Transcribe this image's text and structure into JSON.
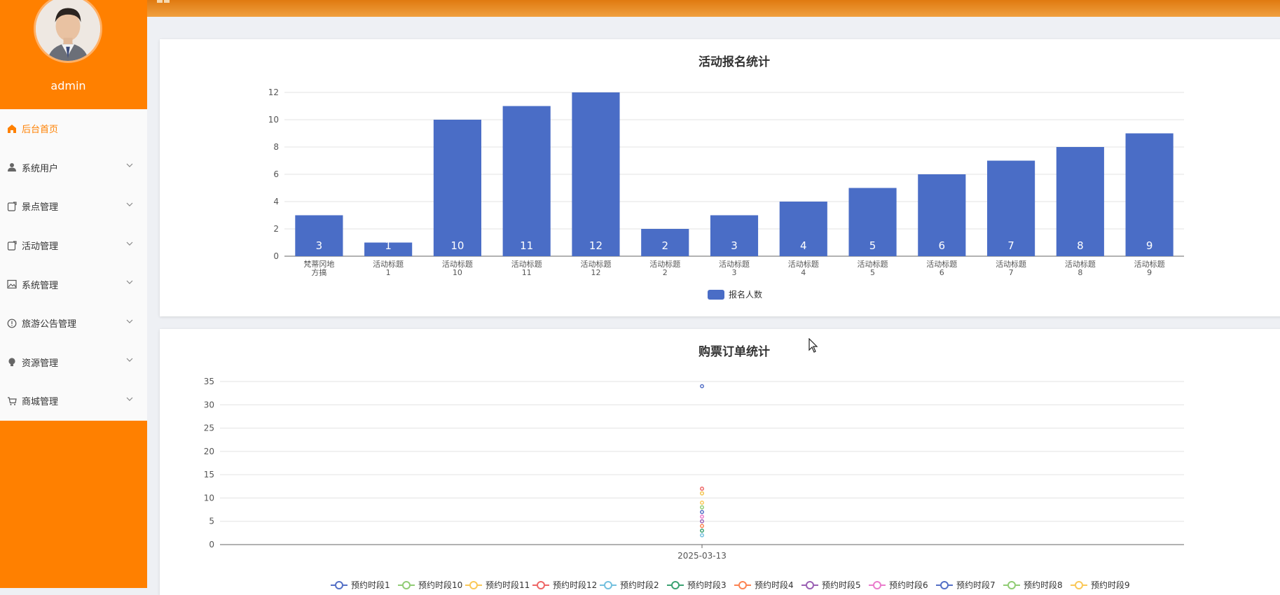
{
  "sidebar": {
    "username": "admin",
    "menu": [
      {
        "label": "后台首页",
        "icon": "home-icon",
        "active": true,
        "expandable": false
      },
      {
        "label": "系统用户",
        "icon": "user-icon",
        "active": false,
        "expandable": true
      },
      {
        "label": "景点管理",
        "icon": "document-icon",
        "active": false,
        "expandable": true
      },
      {
        "label": "活动管理",
        "icon": "document-icon",
        "active": false,
        "expandable": true
      },
      {
        "label": "系统管理",
        "icon": "image-icon",
        "active": false,
        "expandable": true
      },
      {
        "label": "旅游公告管理",
        "icon": "info-icon",
        "active": false,
        "expandable": true
      },
      {
        "label": "资源管理",
        "icon": "bulb-icon",
        "active": false,
        "expandable": true
      },
      {
        "label": "商城管理",
        "icon": "cart-icon",
        "active": false,
        "expandable": true
      }
    ]
  },
  "colors": {
    "brand": "#ff8000",
    "bar": "#4a6dc6",
    "menu_bg": "#fafafa",
    "page_bg": "#eef0f4"
  },
  "chart_data": [
    {
      "type": "bar",
      "title": "活动报名统计",
      "categories": [
        "梵蒂冈地方搞",
        "活动标题1",
        "活动标题10",
        "活动标题11",
        "活动标题12",
        "活动标题2",
        "活动标题3",
        "活动标题4",
        "活动标题5",
        "活动标题6",
        "活动标题7",
        "活动标题8",
        "活动标题9"
      ],
      "category_lines": [
        [
          "梵蒂冈地",
          "方搞"
        ],
        [
          "活动标题",
          "1"
        ],
        [
          "活动标题",
          "10"
        ],
        [
          "活动标题",
          "11"
        ],
        [
          "活动标题",
          "12"
        ],
        [
          "活动标题",
          "2"
        ],
        [
          "活动标题",
          "3"
        ],
        [
          "活动标题",
          "4"
        ],
        [
          "活动标题",
          "5"
        ],
        [
          "活动标题",
          "6"
        ],
        [
          "活动标题",
          "7"
        ],
        [
          "活动标题",
          "8"
        ],
        [
          "活动标题",
          "9"
        ]
      ],
      "series": [
        {
          "name": "报名人数",
          "values": [
            3,
            1,
            10,
            11,
            12,
            2,
            3,
            4,
            5,
            6,
            7,
            8,
            9
          ]
        }
      ],
      "ylim": [
        0,
        12
      ],
      "yticks": [
        0,
        2,
        4,
        6,
        8,
        10,
        12
      ],
      "grid": true,
      "legend": "bottom-center",
      "data_labels": true
    },
    {
      "type": "line",
      "title": "购票订单统计",
      "x": [
        "2025-03-13"
      ],
      "ylim": [
        0,
        35
      ],
      "yticks": [
        0,
        5,
        10,
        15,
        20,
        25,
        30,
        35
      ],
      "grid": true,
      "legend": "bottom-center",
      "series": [
        {
          "name": "预约时段1",
          "color": "#5470c6",
          "values": [
            34
          ]
        },
        {
          "name": "预约时段10",
          "color": "#91cc75",
          "values": [
            11
          ]
        },
        {
          "name": "预约时段11",
          "color": "#fac858",
          "values": [
            11
          ]
        },
        {
          "name": "预约时段12",
          "color": "#ee6666",
          "values": [
            12
          ]
        },
        {
          "name": "预约时段2",
          "color": "#73c0de",
          "values": [
            2
          ]
        },
        {
          "name": "预约时段3",
          "color": "#3ba272",
          "values": [
            3
          ]
        },
        {
          "name": "预约时段4",
          "color": "#fc8452",
          "values": [
            4
          ]
        },
        {
          "name": "预约时段5",
          "color": "#9a60b4",
          "values": [
            5
          ]
        },
        {
          "name": "预约时段6",
          "color": "#ea7ccc",
          "values": [
            6
          ]
        },
        {
          "name": "预约时段7",
          "color": "#5470c6",
          "values": [
            7
          ]
        },
        {
          "name": "预约时段8",
          "color": "#91cc75",
          "values": [
            8
          ]
        },
        {
          "name": "预约时段9",
          "color": "#fac858",
          "values": [
            9
          ]
        }
      ]
    }
  ]
}
